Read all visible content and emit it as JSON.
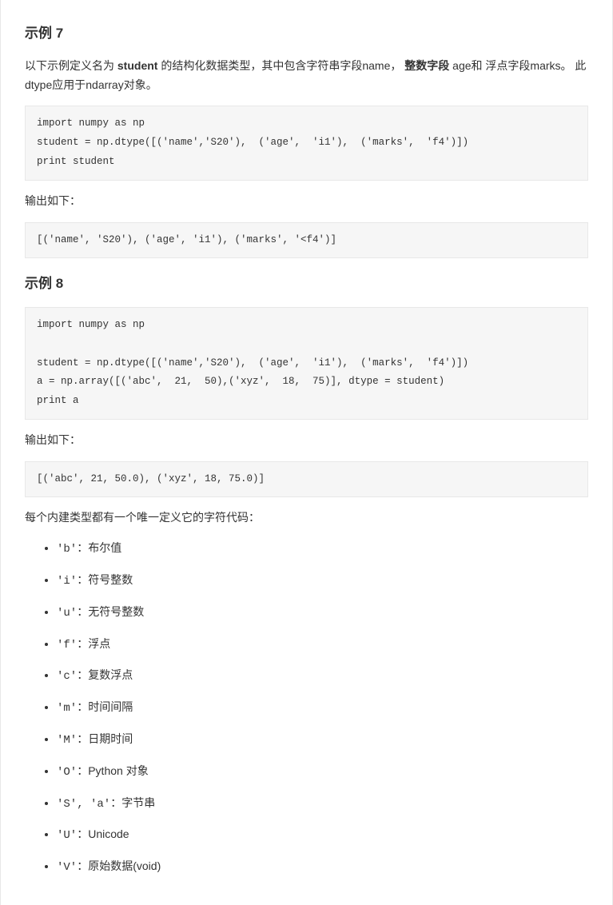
{
  "ex7": {
    "heading": "示例 7",
    "intro_pre": "以下示例定义名为 ",
    "intro_strong1": "student",
    "intro_mid1": " 的结构化数据类型，其中包含字符串字段name，  ",
    "intro_strong2": "整数字段",
    "intro_mid2": " age和 浮点字段marks。 此dtype应用于ndarray对象。",
    "code": "import numpy as np\nstudent = np.dtype([('name','S20'),  ('age',  'i1'),  ('marks',  'f4')])\nprint student",
    "out_label": "输出如下：",
    "out": "[('name', 'S20'), ('age', 'i1'), ('marks', '<f4')]"
  },
  "ex8": {
    "heading": "示例 8",
    "code": "import numpy as np\n\nstudent = np.dtype([('name','S20'),  ('age',  'i1'),  ('marks',  'f4')])\na = np.array([('abc',  21,  50),('xyz',  18,  75)], dtype = student)\nprint a",
    "out_label": "输出如下：",
    "out": "[('abc', 21, 50.0), ('xyz', 18, 75.0)]"
  },
  "typecodes": {
    "intro": "每个内建类型都有一个唯一定义它的字符代码：",
    "items": [
      {
        "code": "'b'",
        "desc": "：布尔值"
      },
      {
        "code": "'i'",
        "desc": "：符号整数"
      },
      {
        "code": "'u'",
        "desc": "：无符号整数"
      },
      {
        "code": "'f'",
        "desc": "：浮点"
      },
      {
        "code": "'c'",
        "desc": "：复数浮点"
      },
      {
        "code": "'m'",
        "desc": "：时间间隔"
      },
      {
        "code": "'M'",
        "desc": "：日期时间"
      },
      {
        "code": "'O'",
        "desc": "：Python 对象"
      },
      {
        "code": "'S', 'a'",
        "desc": "：字节串"
      },
      {
        "code": "'U'",
        "desc": "：Unicode"
      },
      {
        "code": "'V'",
        "desc": "：原始数据(void)"
      }
    ]
  }
}
